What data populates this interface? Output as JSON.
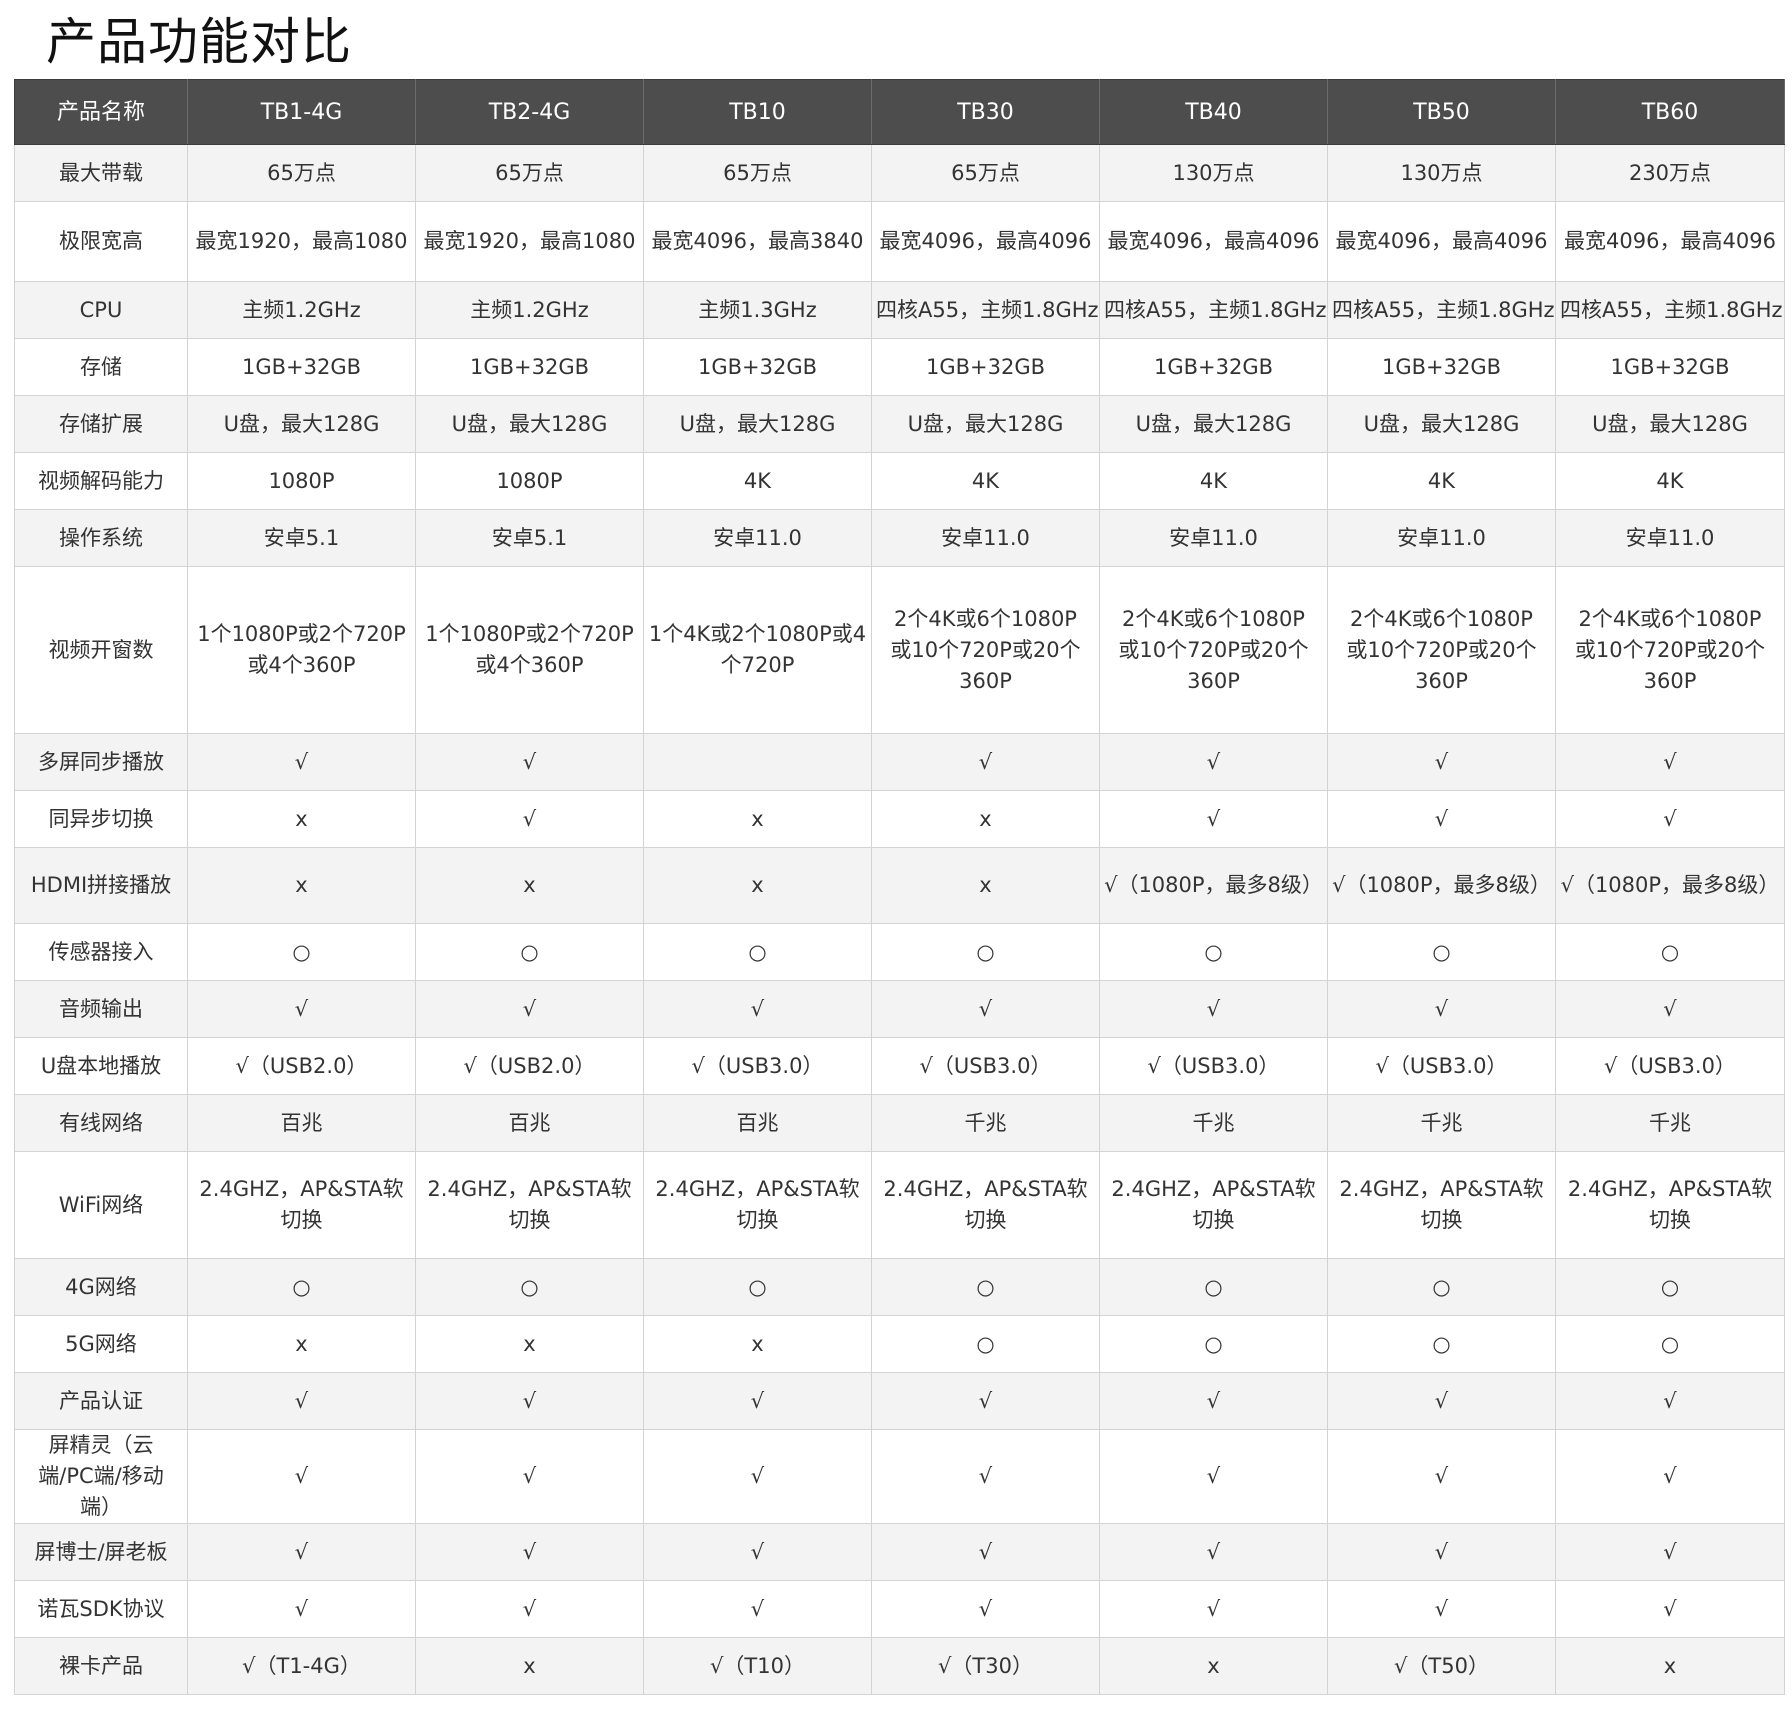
{
  "title": "产品功能对比",
  "table": {
    "headers": [
      "产品名称",
      "TB1-4G",
      "TB2-4G",
      "TB10",
      "TB30",
      "TB40",
      "TB50",
      "TB60"
    ],
    "rows": [
      {
        "label": "最大带载",
        "cells": [
          "65万点",
          "65万点",
          "65万点",
          "65万点",
          "130万点",
          "130万点",
          "230万点"
        ]
      },
      {
        "label": "极限宽高",
        "cells": [
          "最宽1920，最高1080",
          "最宽1920，最高1080",
          "最宽4096，最高3840",
          "最宽4096，最高4096",
          "最宽4096，最高4096",
          "最宽4096，最高4096",
          "最宽4096，最高4096"
        ]
      },
      {
        "label": "CPU",
        "cells": [
          "主频1.2GHz",
          "主频1.2GHz",
          "主频1.3GHz",
          "四核A55，主频1.8GHz",
          "四核A55，主频1.8GHz",
          "四核A55，主频1.8GHz",
          "四核A55，主频1.8GHz"
        ]
      },
      {
        "label": "存储",
        "cells": [
          "1GB+32GB",
          "1GB+32GB",
          "1GB+32GB",
          "1GB+32GB",
          "1GB+32GB",
          "1GB+32GB",
          "1GB+32GB"
        ]
      },
      {
        "label": "存储扩展",
        "cells": [
          "U盘，最大128G",
          "U盘，最大128G",
          "U盘，最大128G",
          "U盘，最大128G",
          "U盘，最大128G",
          "U盘，最大128G",
          "U盘，最大128G"
        ]
      },
      {
        "label": "视频解码能力",
        "cells": [
          "1080P",
          "1080P",
          "4K",
          "4K",
          "4K",
          "4K",
          "4K"
        ]
      },
      {
        "label": "操作系统",
        "cells": [
          "安卓5.1",
          "安卓5.1",
          "安卓11.0",
          "安卓11.0",
          "安卓11.0",
          "安卓11.0",
          "安卓11.0"
        ]
      },
      {
        "label": "视频开窗数",
        "cells": [
          "1个1080P或2个720P或4个360P",
          "1个1080P或2个720P或4个360P",
          "1个4K或2个1080P或4个720P",
          "2个4K或6个1080P或10个720P或20个360P",
          "2个4K或6个1080P或10个720P或20个360P",
          "2个4K或6个1080P或10个720P或20个360P",
          "2个4K或6个1080P或10个720P或20个360P"
        ]
      },
      {
        "label": "多屏同步播放",
        "cells": [
          "√",
          "√",
          "",
          "√",
          "√",
          "√",
          "√"
        ]
      },
      {
        "label": "同异步切换",
        "cells": [
          "x",
          "√",
          "x",
          "x",
          "√",
          "√",
          "√"
        ]
      },
      {
        "label": "HDMI拼接播放",
        "cells": [
          "x",
          "x",
          "x",
          "x",
          "√（1080P，最多8级）",
          "√（1080P，最多8级）",
          "√（1080P，最多8级）"
        ]
      },
      {
        "label": "传感器接入",
        "cells": [
          "○",
          "○",
          "○",
          "○",
          "○",
          "○",
          "○"
        ]
      },
      {
        "label": "音频输出",
        "cells": [
          "√",
          "√",
          "√",
          "√",
          "√",
          "√",
          "√"
        ]
      },
      {
        "label": "U盘本地播放",
        "cells": [
          "√（USB2.0）",
          "√（USB2.0）",
          "√（USB3.0）",
          "√（USB3.0）",
          "√（USB3.0）",
          "√（USB3.0）",
          "√（USB3.0）"
        ]
      },
      {
        "label": "有线网络",
        "cells": [
          "百兆",
          "百兆",
          "百兆",
          "千兆",
          "千兆",
          "千兆",
          "千兆"
        ]
      },
      {
        "label": "WiFi网络",
        "cells": [
          "2.4GHZ，AP&STA软切换",
          "2.4GHZ，AP&STA软切换",
          "2.4GHZ，AP&STA软切换",
          "2.4GHZ，AP&STA软切换",
          "2.4GHZ，AP&STA软切换",
          "2.4GHZ，AP&STA软切换",
          "2.4GHZ，AP&STA软切换"
        ]
      },
      {
        "label": "4G网络",
        "cells": [
          "○",
          "○",
          "○",
          "○",
          "○",
          "○",
          "○"
        ]
      },
      {
        "label": "5G网络",
        "cells": [
          "x",
          "x",
          "x",
          "○",
          "○",
          "○",
          "○"
        ]
      },
      {
        "label": "产品认证",
        "cells": [
          "√",
          "√",
          "√",
          "√",
          "√",
          "√",
          "√"
        ]
      },
      {
        "label": "屏精灵（云端/PC端/移动端）",
        "cells": [
          "√",
          "√",
          "√",
          "√",
          "√",
          "√",
          "√"
        ]
      },
      {
        "label": "屏博士/屏老板",
        "cells": [
          "√",
          "√",
          "√",
          "√",
          "√",
          "√",
          "√"
        ]
      },
      {
        "label": "诺瓦SDK协议",
        "cells": [
          "√",
          "√",
          "√",
          "√",
          "√",
          "√",
          "√"
        ]
      },
      {
        "label": "裸卡产品",
        "cells": [
          "√（T1-4G）",
          "x",
          "√（T10）",
          "√（T30）",
          "x",
          "√（T50）",
          "x"
        ]
      }
    ]
  }
}
